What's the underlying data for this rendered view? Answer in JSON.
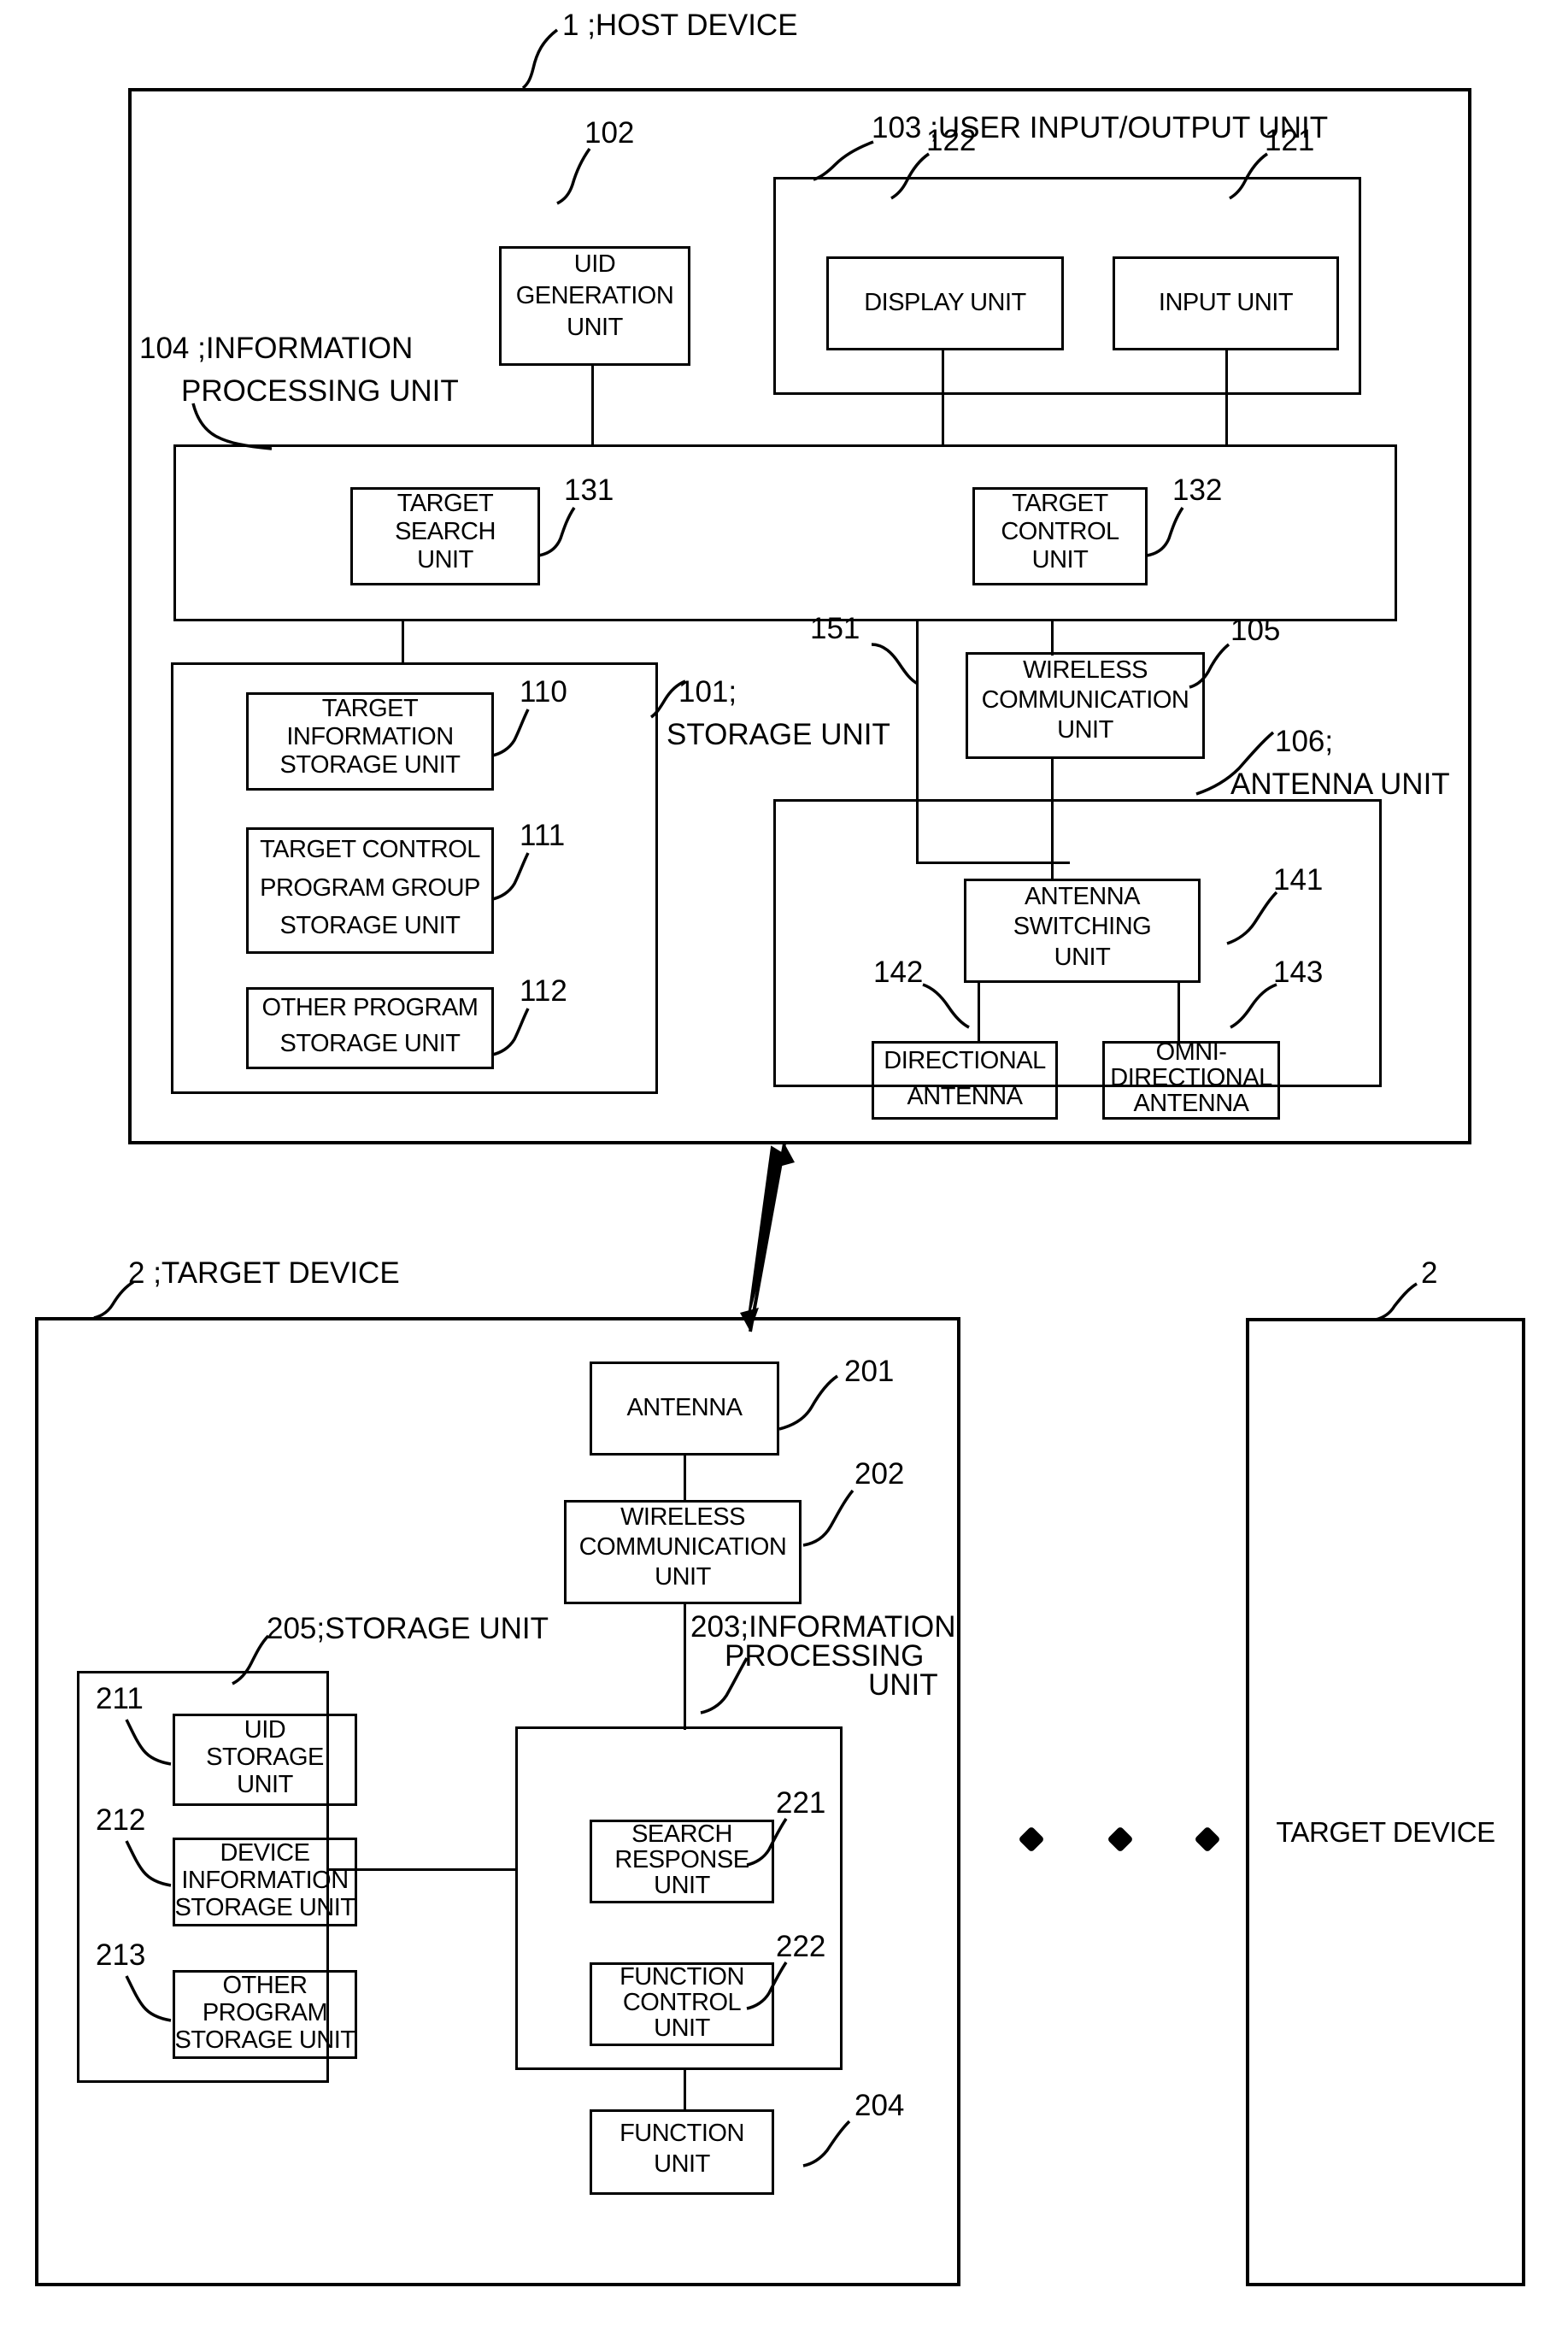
{
  "figure": {
    "host_device": {
      "ref": "1",
      "label": "1 ;HOST DEVICE",
      "user_io_unit": {
        "ref": "103",
        "label": "103 ;USER INPUT/OUTPUT UNIT",
        "display_unit": {
          "ref": "122",
          "label": "DISPLAY UNIT"
        },
        "input_unit": {
          "ref": "121",
          "label": "INPUT UNIT"
        }
      },
      "uid_generation_unit": {
        "ref": "102",
        "label": "UID\nGENERATION\nUNIT",
        "l1": "UID",
        "l2": "GENERATION",
        "l3": "UNIT"
      },
      "information_processing_unit": {
        "ref": "104",
        "label": "104 ;INFORMATION",
        "label2": "PROCESSING UNIT",
        "target_search_unit": {
          "ref": "131",
          "l1": "TARGET",
          "l2": "SEARCH",
          "l3": "UNIT"
        },
        "target_control_unit": {
          "ref": "132",
          "l1": "TARGET",
          "l2": "CONTROL",
          "l3": "UNIT"
        }
      },
      "storage_unit": {
        "ref": "101",
        "label": "101;",
        "label2": "STORAGE UNIT",
        "target_information_storage_unit": {
          "ref": "110",
          "l1": "TARGET",
          "l2": "INFORMATION",
          "l3": "STORAGE UNIT"
        },
        "target_control_program_group_storage_unit": {
          "ref": "111",
          "l1": "TARGET CONTROL",
          "l2": "PROGRAM GROUP",
          "l3": "STORAGE UNIT"
        },
        "other_program_storage_unit": {
          "ref": "112",
          "l1": "OTHER PROGRAM",
          "l2": "STORAGE UNIT"
        }
      },
      "bus": {
        "ref": "151"
      },
      "wireless_communication_unit": {
        "ref": "105",
        "l1": "WIRELESS",
        "l2": "COMMUNICATION",
        "l3": "UNIT"
      },
      "antenna_unit": {
        "ref": "106",
        "label": "106;",
        "label2": "ANTENNA UNIT",
        "antenna_switching_unit": {
          "ref": "141",
          "l1": "ANTENNA",
          "l2": "SWITCHING",
          "l3": "UNIT"
        },
        "directional_antenna": {
          "ref": "142",
          "l1": "DIRECTIONAL",
          "l2": "ANTENNA"
        },
        "omni_directional_antenna": {
          "ref": "143",
          "l1": "OMNI-",
          "l2": "DIRECTIONAL",
          "l3": "ANTENNA"
        }
      }
    },
    "target_device": {
      "ref": "2",
      "label": "2 ;TARGET DEVICE",
      "antenna": {
        "ref": "201",
        "label": "ANTENNA"
      },
      "wireless_communication_unit": {
        "ref": "202",
        "l1": "WIRELESS",
        "l2": "COMMUNICATION",
        "l3": "UNIT"
      },
      "storage_unit": {
        "ref": "205",
        "label": "205;STORAGE UNIT",
        "uid_storage_unit": {
          "ref": "211",
          "l1": "UID",
          "l2": "STORAGE",
          "l3": "UNIT"
        },
        "device_information_storage_unit": {
          "ref": "212",
          "l1": "DEVICE",
          "l2": "INFORMATION",
          "l3": "STORAGE UNIT"
        },
        "other_program_storage_unit": {
          "ref": "213",
          "l1": "OTHER",
          "l2": "PROGRAM",
          "l3": "STORAGE UNIT"
        }
      },
      "information_processing_unit": {
        "ref": "203",
        "label": "203;INFORMATION",
        "label2": "PROCESSING",
        "label3": "UNIT",
        "search_response_unit": {
          "ref": "221",
          "l1": "SEARCH",
          "l2": "RESPONSE",
          "l3": "UNIT"
        },
        "function_control_unit": {
          "ref": "222",
          "l1": "FUNCTION",
          "l2": "CONTROL",
          "l3": "UNIT"
        }
      },
      "function_unit": {
        "ref": "204",
        "l1": "FUNCTION",
        "l2": "UNIT"
      }
    },
    "target_device_right": {
      "ref": "2",
      "label": "TARGET DEVICE"
    },
    "ellipsis": "dots-separator"
  }
}
